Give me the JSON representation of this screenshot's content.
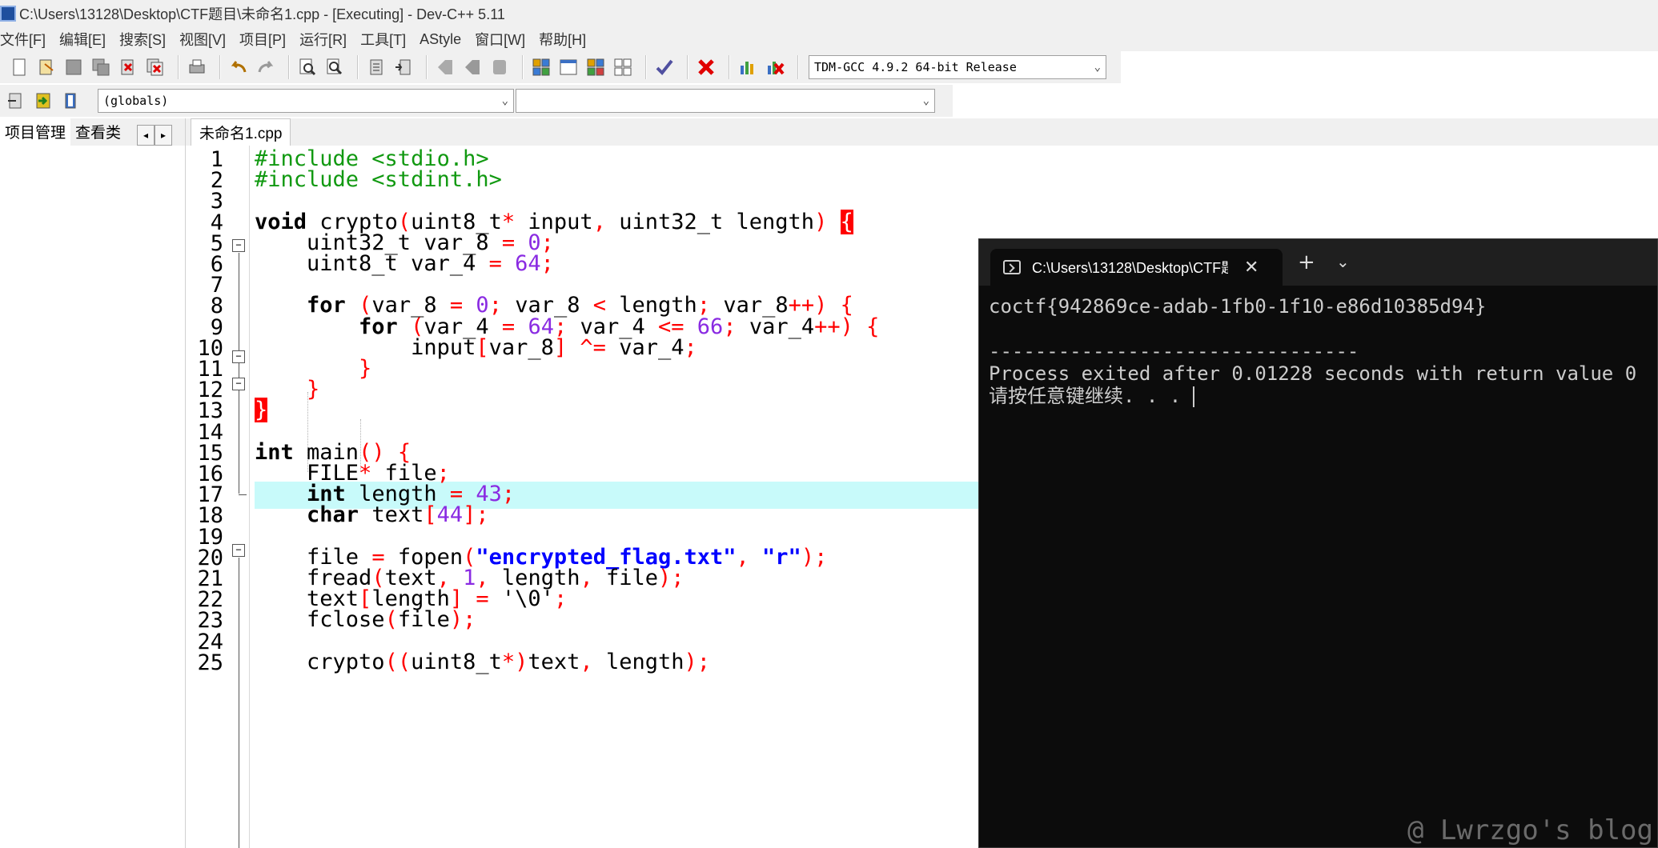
{
  "window": {
    "title": "C:\\Users\\13128\\Desktop\\CTF题目\\未命名1.cpp - [Executing] - Dev-C++ 5.11"
  },
  "menu": [
    "文件[F]",
    "编辑[E]",
    "搜索[S]",
    "视图[V]",
    "项目[P]",
    "运行[R]",
    "工具[T]",
    "AStyle",
    "窗口[W]",
    "帮助[H]"
  ],
  "toolbar": {
    "compiler": "TDM-GCC 4.9.2 64-bit Release",
    "scope": "(globals)",
    "member": ""
  },
  "left_panel": {
    "tabs": [
      "项目管理",
      "查看类"
    ]
  },
  "editor": {
    "tab": "未命名1.cpp",
    "line_numbers": [
      "1",
      "2",
      "3",
      "4",
      "5",
      "6",
      "7",
      "8",
      "9",
      "10",
      "11",
      "12",
      "13",
      "14",
      "15",
      "16",
      "17",
      "18",
      "19",
      "20",
      "21",
      "22",
      "23",
      "24",
      "25"
    ],
    "lines": [
      "#include <stdio.h>",
      "#include <stdint.h>",
      "",
      "void crypto(uint8_t* input, uint32_t length) {",
      "    uint32_t var_8 = 0;",
      "    uint8_t var_4 = 64;",
      "",
      "    for (var_8 = 0; var_8 < length; var_8++) {",
      "        for (var_4 = 64; var_4 <= 66; var_4++) {",
      "            input[var_8] ^= var_4;",
      "        }",
      "    }",
      "}",
      "",
      "int main() {",
      "    FILE* file;",
      "    int length = 43;",
      "    char text[44];",
      "",
      "    file = fopen(\"encrypted_flag.txt\", \"r\");",
      "    fread(text, 1, length, file);",
      "    text[length] = '\\0';",
      "    fclose(file);",
      "",
      "    crypto((uint8_t*)text, length);"
    ]
  },
  "console": {
    "tab_title": "C:\\Users\\13128\\Desktop\\CTF题",
    "output": [
      "coctf{942869ce-adab-1fb0-1f10-e86d10385d94}",
      "",
      "--------------------------------",
      "Process exited after 0.01228 seconds with return value 0",
      "请按任意键继续. . . "
    ]
  },
  "watermark": "@ Lwrzgo's blog",
  "colors": {
    "console_bg": "#0c0c0c",
    "current_line": "#c8fafa",
    "preprocessor": "#119911",
    "number": "#8a2be2",
    "operator": "#ff0000",
    "string": "#0000ff"
  }
}
